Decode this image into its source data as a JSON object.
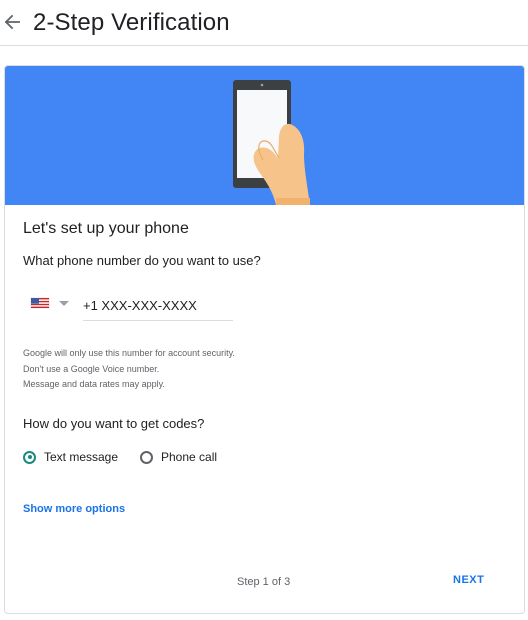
{
  "header": {
    "back_icon": "arrow-left-icon",
    "title": "2-Step Verification"
  },
  "hero": {
    "image": "phone-in-hand-illustration",
    "background": "#4285f4"
  },
  "setup": {
    "title": "Let's set up your phone",
    "question": "What phone number do you want to use?",
    "country": "United States",
    "country_icon": "us-flag-icon",
    "phone_placeholder": "+1 XXX-XXX-XXXX",
    "phone_value": ""
  },
  "help": {
    "line1": "Google will only use this number for account security.",
    "line2": "Don't use a Google Voice number.",
    "line3": "Message and data rates may apply."
  },
  "codes": {
    "question": "How do you want to get codes?",
    "options": [
      {
        "label": "Text message",
        "selected": true
      },
      {
        "label": "Phone call",
        "selected": false
      }
    ]
  },
  "footer": {
    "more_options": "Show more options",
    "step": "Step 1 of 3",
    "next": "NEXT"
  },
  "colors": {
    "accent": "#1a73e8",
    "radio_selected": "#1a8a7d",
    "hero": "#4285f4"
  }
}
